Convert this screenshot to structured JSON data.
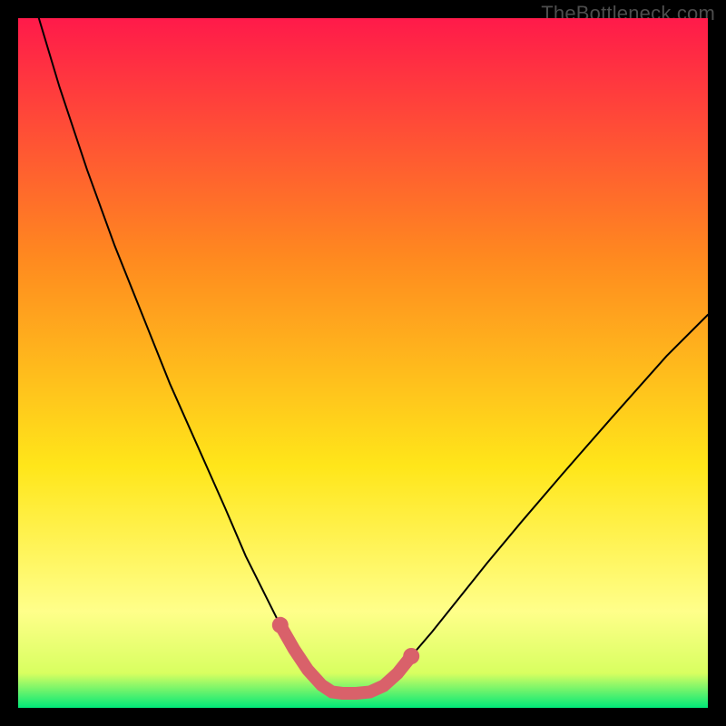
{
  "watermark": "TheBottleneck.com",
  "colors": {
    "bg_black": "#000000",
    "grad_top": "#ff1a4a",
    "grad_mid1": "#ff8a1f",
    "grad_mid2": "#ffe61a",
    "grad_lowlight": "#ffff8a",
    "grad_nearbottom": "#d8ff60",
    "grad_bottom": "#00e878",
    "curve": "#000000",
    "highlight": "#d9616a"
  },
  "chart_data": {
    "type": "line",
    "title": "",
    "xlabel": "",
    "ylabel": "",
    "xlim": [
      0,
      100
    ],
    "ylim": [
      0,
      100
    ],
    "series": [
      {
        "name": "bottleneck-curve",
        "x": [
          3,
          6,
          10,
          14,
          18,
          22,
          26,
          30,
          33,
          36,
          38,
          40,
          42,
          44,
          45.5,
          47,
          49,
          51,
          53,
          55,
          57,
          60,
          64,
          68,
          73,
          79,
          86,
          94,
          100
        ],
        "y": [
          100,
          90,
          78,
          67,
          57,
          47,
          38,
          29,
          22,
          16,
          12,
          8.5,
          5.5,
          3.3,
          2.3,
          2.1,
          2.1,
          2.3,
          3.2,
          5.0,
          7.5,
          11,
          16,
          21,
          27,
          34,
          42,
          51,
          57
        ]
      },
      {
        "name": "highlight-segment",
        "x": [
          38,
          40,
          42,
          44,
          45.5,
          47,
          49,
          51,
          53,
          55,
          57
        ],
        "y": [
          12,
          8.5,
          5.5,
          3.3,
          2.3,
          2.1,
          2.1,
          2.3,
          3.2,
          5.0,
          7.5
        ]
      }
    ],
    "annotations": []
  }
}
